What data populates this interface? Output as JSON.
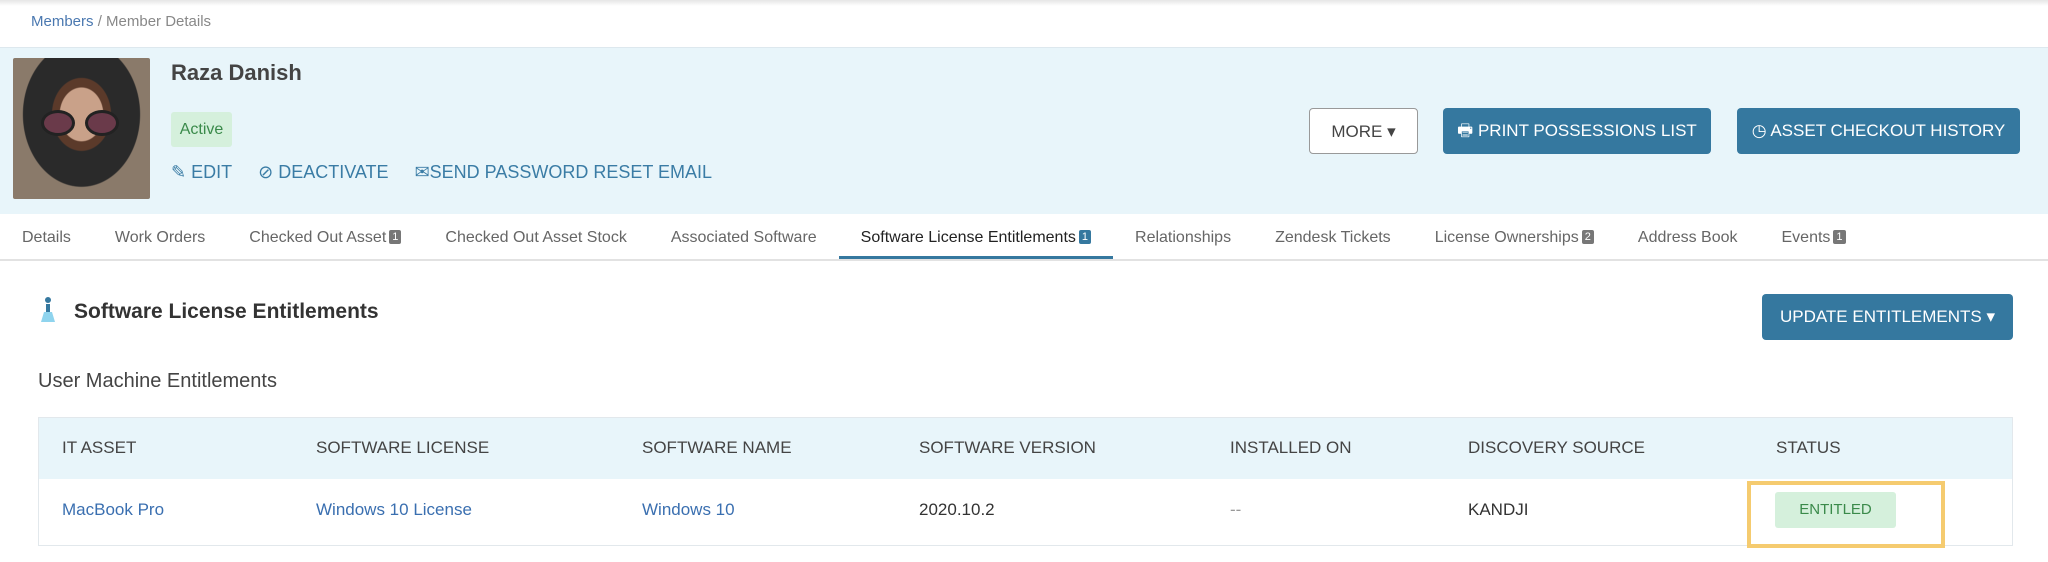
{
  "breadcrumb": {
    "parent": "Members",
    "separator": "/",
    "current": "Member Details"
  },
  "member": {
    "name": "Raza Danish",
    "status": "Active"
  },
  "actions": {
    "edit": "EDIT",
    "deactivate": "DEACTIVATE",
    "reset": "SEND PASSWORD RESET EMAIL",
    "more": "MORE ▾",
    "print": "PRINT POSSESSIONS LIST",
    "history": "ASSET CHECKOUT HISTORY"
  },
  "tabs": [
    {
      "label": "Details"
    },
    {
      "label": "Work Orders"
    },
    {
      "label": "Checked Out Asset",
      "count": "1"
    },
    {
      "label": "Checked Out Asset Stock"
    },
    {
      "label": "Associated Software"
    },
    {
      "label": "Software License Entitlements",
      "count": "1"
    },
    {
      "label": "Relationships"
    },
    {
      "label": "Zendesk Tickets"
    },
    {
      "label": "License Ownerships",
      "count": "2"
    },
    {
      "label": "Address Book"
    },
    {
      "label": "Events",
      "count": "1"
    }
  ],
  "section": {
    "title": "Software License Entitlements",
    "update_button": "UPDATE ENTITLEMENTS ▾",
    "subtitle": "User Machine Entitlements"
  },
  "table": {
    "headers": [
      "IT ASSET",
      "SOFTWARE LICENSE",
      "SOFTWARE NAME",
      "SOFTWARE VERSION",
      "INSTALLED ON",
      "DISCOVERY SOURCE",
      "STATUS"
    ],
    "row": {
      "asset": "MacBook Pro",
      "license": "Windows 10 License",
      "name": "Windows 10",
      "version": "2020.10.2",
      "installed_on": "--",
      "source": "KANDJI",
      "status": "ENTITLED"
    }
  },
  "colors": {
    "primary": "#35789f",
    "header_bg": "#e8f5fa",
    "highlight": "#f5cb6f"
  }
}
